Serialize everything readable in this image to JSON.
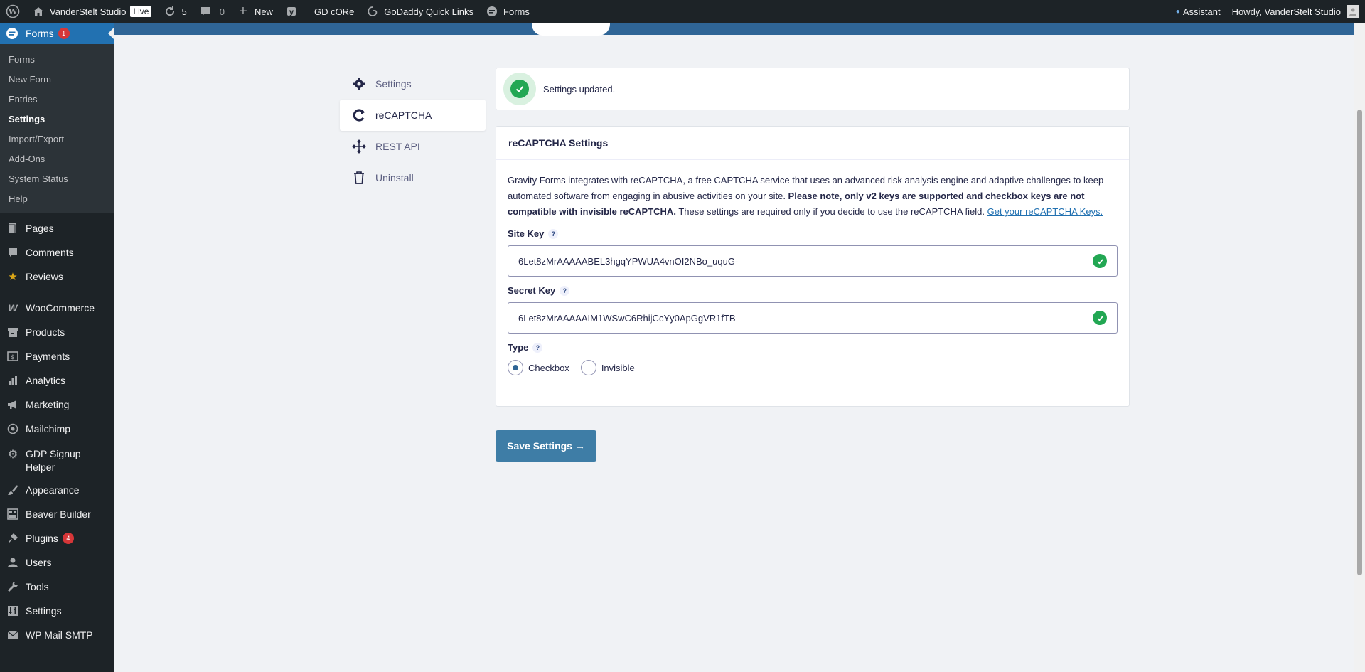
{
  "adminbar": {
    "site_name": "VanderStelt Studio",
    "live_badge": "Live",
    "updates_count": "5",
    "comments_count": "0",
    "new_label": "New",
    "gd_core": "GD cORe",
    "godaddy_links": "GoDaddy Quick Links",
    "forms_label": "Forms",
    "assistant": "Assistant",
    "howdy": "Howdy, VanderStelt Studio"
  },
  "sidebar": {
    "current": {
      "label": "Forms",
      "badge": "1"
    },
    "submenu": [
      {
        "label": "Forms"
      },
      {
        "label": "New Form"
      },
      {
        "label": "Entries"
      },
      {
        "label": "Settings"
      },
      {
        "label": "Import/Export"
      },
      {
        "label": "Add-Ons"
      },
      {
        "label": "System Status"
      },
      {
        "label": "Help"
      }
    ],
    "items": [
      {
        "label": "Pages"
      },
      {
        "label": "Comments"
      },
      {
        "label": "Reviews"
      },
      {
        "label": "WooCommerce"
      },
      {
        "label": "Products"
      },
      {
        "label": "Payments"
      },
      {
        "label": "Analytics"
      },
      {
        "label": "Marketing"
      },
      {
        "label": "Mailchimp"
      },
      {
        "label": "GDP Signup Helper"
      },
      {
        "label": "Appearance"
      },
      {
        "label": "Beaver Builder"
      },
      {
        "label": "Plugins",
        "badge": "4"
      },
      {
        "label": "Users"
      },
      {
        "label": "Tools"
      },
      {
        "label": "Settings"
      },
      {
        "label": "WP Mail SMTP"
      }
    ]
  },
  "settings_nav": [
    {
      "label": "Settings"
    },
    {
      "label": "reCAPTCHA"
    },
    {
      "label": "REST API"
    },
    {
      "label": "Uninstall"
    }
  ],
  "notice": {
    "text": "Settings updated."
  },
  "panel": {
    "title": "reCAPTCHA Settings",
    "desc_part1": "Gravity Forms integrates with reCAPTCHA, a free CAPTCHA service that uses an advanced risk analysis engine and adaptive challenges to keep automated software from engaging in abusive activities on your site. ",
    "desc_bold": "Please note, only v2 keys are supported and checkbox keys are not compatible with invisible reCAPTCHA.",
    "desc_part2": " These settings are required only if you decide to use the reCAPTCHA field. ",
    "desc_link": "Get your reCAPTCHA Keys.",
    "site_key_label": "Site Key",
    "site_key_value": "6Let8zMrAAAAABEL3hgqYPWUA4vnOI2NBo_uquG-",
    "secret_key_label": "Secret Key",
    "secret_key_value": "6Let8zMrAAAAAIM1WSwC6RhijCcYy0ApGgVR1fTB",
    "type_label": "Type",
    "help_mark": "?",
    "type_options": [
      {
        "label": "Checkbox",
        "checked": true
      },
      {
        "label": "Invisible",
        "checked": false
      }
    ]
  },
  "save_button": "Save Settings  →",
  "colors": {
    "accent": "#2271b1",
    "success": "#22a753",
    "button": "#3e7da6",
    "header": "#2f6596"
  }
}
